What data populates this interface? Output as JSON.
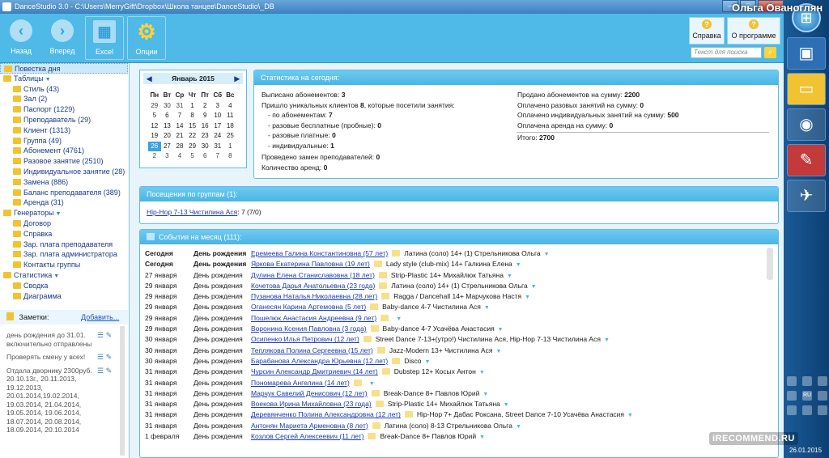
{
  "window": {
    "title": "DanceStudio 3.0 - C:\\Users\\MerryGift\\Dropbox\\Школа танцев\\DanceStudio\\_DB",
    "user": "Ольга Ованоглян",
    "min": "–",
    "max": "□",
    "close": "✕"
  },
  "toolbar": {
    "back": "Назад",
    "forward": "Вперед",
    "excel": "Excel",
    "options": "Опции",
    "help": "Справка",
    "about": "О программе",
    "search_placeholder": "Текст для поиска"
  },
  "tree": [
    {
      "label": "Повестка дня",
      "level": 0,
      "selected": true
    },
    {
      "label": "Таблицы",
      "level": 0,
      "arrow": true
    },
    {
      "label": "Стиль (43)",
      "level": 1
    },
    {
      "label": "Зал (2)",
      "level": 1
    },
    {
      "label": "Паспорт (1229)",
      "level": 1
    },
    {
      "label": "Преподаватель (29)",
      "level": 1
    },
    {
      "label": "Клиент (1313)",
      "level": 1
    },
    {
      "label": "Группа (49)",
      "level": 1
    },
    {
      "label": "Абонемент (4761)",
      "level": 1
    },
    {
      "label": "Разовое занятие (2510)",
      "level": 1
    },
    {
      "label": "Индивидуальное занятие (28)",
      "level": 1
    },
    {
      "label": "Замена (886)",
      "level": 1
    },
    {
      "label": "Баланс преподавателя (389)",
      "level": 1
    },
    {
      "label": "Аренда (31)",
      "level": 1
    },
    {
      "label": "Генераторы",
      "level": 0,
      "arrow": true
    },
    {
      "label": "Договор",
      "level": 1
    },
    {
      "label": "Справка",
      "level": 1
    },
    {
      "label": "Зар. плата преподавателя",
      "level": 1
    },
    {
      "label": "Зар. плата администратора",
      "level": 1
    },
    {
      "label": "Контакты группы",
      "level": 1
    },
    {
      "label": "Статистика",
      "level": 0,
      "arrow": true
    },
    {
      "label": "Сводка",
      "level": 1
    },
    {
      "label": "Диаграмма",
      "level": 1
    }
  ],
  "notes": {
    "title": "Заметки:",
    "add": "Добавить...",
    "items": [
      "день рождения до 31.01. включительно отправлены",
      "Проверять смену у всех!",
      "Отдала дворнику 2300руб. 20.10.13г., 20.11.2013, 19.12.2013, 20.01.2014,19.02.2014, 19.03.2014, 21.04.2014, 19.05.2014, 19.06.2014, 18.07.2014, 20.08.2014, 18.09.2014, 20.10.2014"
    ]
  },
  "calendar": {
    "month": "Январь 2015",
    "weekdays": [
      "Пн",
      "Вт",
      "Ср",
      "Чт",
      "Пт",
      "Сб",
      "Вс"
    ],
    "weeks": [
      [
        "29",
        "30",
        "31",
        "1",
        "2",
        "3",
        "4"
      ],
      [
        "5",
        "6",
        "7",
        "8",
        "9",
        "10",
        "11"
      ],
      [
        "12",
        "13",
        "14",
        "15",
        "16",
        "17",
        "18"
      ],
      [
        "19",
        "20",
        "21",
        "22",
        "23",
        "24",
        "25"
      ],
      [
        "26",
        "27",
        "28",
        "29",
        "30",
        "31",
        "1"
      ],
      [
        "2",
        "3",
        "4",
        "5",
        "6",
        "7",
        "8"
      ]
    ],
    "today": "26"
  },
  "stats": {
    "title": "Статистика на сегодня:",
    "left": [
      {
        "label": "Выписано абонементов:",
        "value": "3"
      },
      {
        "label": "Пришло уникальных клиентов",
        "value": "8",
        "suffix": ", которые посетили занятия:"
      },
      {
        "label": "- по абонементам:",
        "value": "7",
        "indent": true
      },
      {
        "label": "- разовые бесплатные (пробные):",
        "value": "0",
        "indent": true
      },
      {
        "label": "- разовые платные:",
        "value": "0",
        "indent": true
      },
      {
        "label": "- индивидуальные:",
        "value": "1",
        "indent": true
      },
      {
        "label": "Проведено замен преподавателей:",
        "value": "0"
      },
      {
        "label": "Количество аренд:",
        "value": "0"
      }
    ],
    "right": [
      {
        "label": "Продано абонементов на сумму:",
        "value": "2200"
      },
      {
        "label": "Оплачено разовых занятий на сумму:",
        "value": "0"
      },
      {
        "label": "Оплачено индивидуальных занятий на сумму:",
        "value": "500"
      },
      {
        "label": "Оплачена аренда на сумму:",
        "value": "0"
      },
      {
        "label": "Итого:",
        "value": "2700"
      }
    ]
  },
  "visits": {
    "title": "Посещения по группам (1):",
    "group": "Hip-Hop 7-13 Чистилина Ася",
    "count": ": 7 (7/0)"
  },
  "events": {
    "title": "События на месяц (111):",
    "rows": [
      {
        "date": "Сегодня",
        "type": "День рождения",
        "name": "Еремеева Галина Константиновна (57 лет)",
        "info": "Латина (соло) 14+ (1) Стрельникова Ольга",
        "bold": true
      },
      {
        "date": "Сегодня",
        "type": "День рождения",
        "name": "Яркова Екатерина Павловна (19 лет)",
        "info": "Lady style (club-mix) 14+ Галкина Елена",
        "bold": true
      },
      {
        "date": "27 января",
        "type": "День рождения",
        "name": "Дулина Елена Станиславовна (18 лет)",
        "info": "Strip-Plastic 14+ Михайлюк Татьяна"
      },
      {
        "date": "29 января",
        "type": "День рождения",
        "name": "Кочетова Дарья Анатольевна (23 года)",
        "info": "Латина (соло) 14+ (1) Стрельникова Ольга"
      },
      {
        "date": "29 января",
        "type": "День рождения",
        "name": "Пузанова Наталья Николаевна (28 лет)",
        "info": "Ragga / Dancehall 14+ Марчукова Настя"
      },
      {
        "date": "29 января",
        "type": "День рождения",
        "name": "Оганесян Карина Артемовна (5 лет)",
        "info": "Baby-dance 4-7 Чистилина Ася"
      },
      {
        "date": "29 января",
        "type": "День рождения",
        "name": "Пошелюк Анастасия Андреевна (9 лет)",
        "info": ""
      },
      {
        "date": "29 января",
        "type": "День рождения",
        "name": "Воронина Ксения Павловна (3 года)",
        "info": "Baby-dance 4-7 Усачёва Анастасия"
      },
      {
        "date": "30 января",
        "type": "День рождения",
        "name": "Осипенко Илья Петрович (12 лет)",
        "info": "Street Dance 7-13+(утро!) Чистилина Ася, Hip-Hop 7-13 Чистилина Ася"
      },
      {
        "date": "30 января",
        "type": "День рождения",
        "name": "Теплякова Полина Сергеевна (15 лет)",
        "info": "Jazz-Modern 13+ Чистилина Ася"
      },
      {
        "date": "30 января",
        "type": "День рождения",
        "name": "Барабанова Александра Юрьевна (12 лет)",
        "info": "Disco"
      },
      {
        "date": "31 января",
        "type": "День рождения",
        "name": "Чурсин Александр Дмитриевич (14 лет)",
        "info": "Dubstep 12+ Косых Антон"
      },
      {
        "date": "31 января",
        "type": "День рождения",
        "name": "Пономарева Ангелина (14 лет)",
        "info": ""
      },
      {
        "date": "31 января",
        "type": "День рождения",
        "name": "Марчук Савелий Денисович (12 лет)",
        "info": "Break-Dance 8+ Павлов Юрий"
      },
      {
        "date": "31 января",
        "type": "День рождения",
        "name": "Воекова Ирина Михайловна (23 года)",
        "info": "Strip-Plastic 14+ Михайлюк Татьяна"
      },
      {
        "date": "31 января",
        "type": "День рождения",
        "name": "Деревянченко Полина Александровна (12 лет)",
        "info": "Hip-Hop 7+ Дабас Роксана, Street Dance 7-10 Усачёва Анастасия"
      },
      {
        "date": "31 января",
        "type": "День рождения",
        "name": "Антонян Мариета Арменовна (8 лет)",
        "info": "Латина (соло) 8-13 Стрельникова Ольга"
      },
      {
        "date": "1 февраля",
        "type": "День рождения",
        "name": "Козлов Сергей Алексеевич (11 лет)",
        "info": "Break-Dance 8+ Павлов Юрий"
      }
    ]
  },
  "taskbar": {
    "start": "⊞",
    "icons": [
      "floppy-icon",
      "folder-icon",
      "chrome-icon",
      "edit-icon",
      "pin-icon"
    ],
    "tray_ru": "RU",
    "date": "26.01.2015"
  },
  "watermark": "iRECOMMEND.RU"
}
